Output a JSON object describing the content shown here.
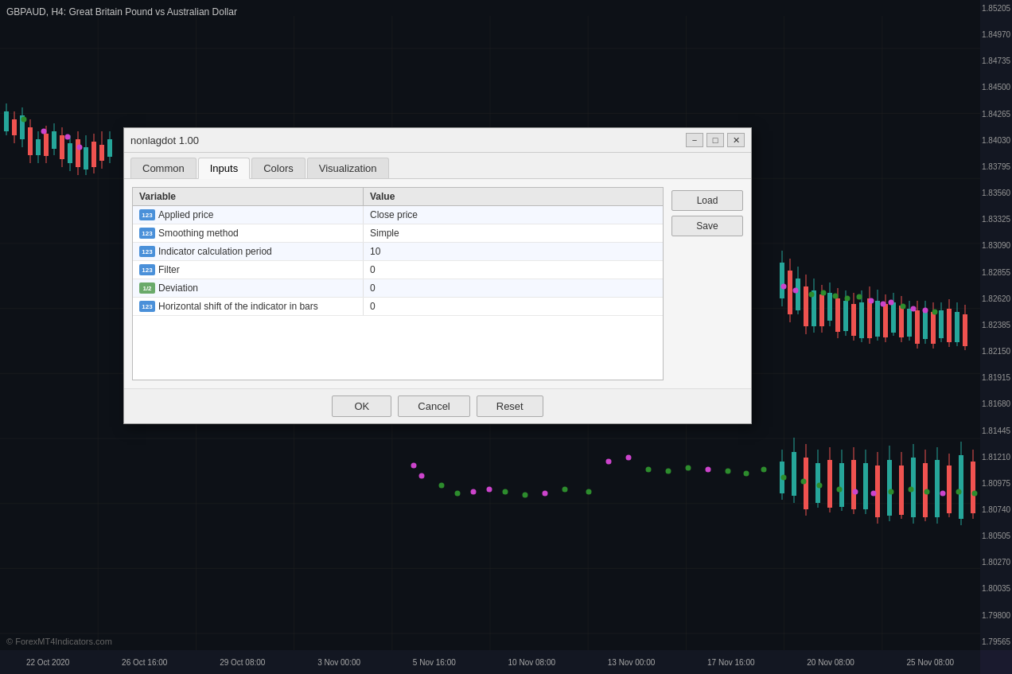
{
  "chart": {
    "title": "GBPAUD, H4:  Great Britain Pound vs Australian Dollar",
    "watermark": "© ForexMT4Indicators.com",
    "price_labels": [
      "1.85205",
      "1.84970",
      "1.84735",
      "1.84500",
      "1.84265",
      "1.84030",
      "1.83795",
      "1.83560",
      "1.83325",
      "1.83090",
      "1.82855",
      "1.82620",
      "1.82385",
      "1.82150",
      "1.81915",
      "1.81680",
      "1.81445",
      "1.81210",
      "1.80975",
      "1.80740",
      "1.80505",
      "1.80270",
      "1.80035",
      "1.79800",
      "1.79565"
    ],
    "time_labels": [
      "22 Oct 2020",
      "26 Oct 16:00",
      "29 Oct 08:00",
      "3 Nov 00:00",
      "5 Nov 16:00",
      "10 Nov 08:00",
      "13 Nov 00:00",
      "17 Nov 16:00",
      "20 Nov 08:00",
      "25 Nov 08:00"
    ]
  },
  "dialog": {
    "title": "nonlagdot 1.00",
    "tabs": [
      {
        "id": "common",
        "label": "Common",
        "active": false
      },
      {
        "id": "inputs",
        "label": "Inputs",
        "active": true
      },
      {
        "id": "colors",
        "label": "Colors",
        "active": false
      },
      {
        "id": "visualization",
        "label": "Visualization",
        "active": false
      }
    ],
    "minimize_label": "−",
    "maximize_label": "□",
    "close_label": "✕",
    "table": {
      "col_variable": "Variable",
      "col_value": "Value",
      "rows": [
        {
          "type": "123",
          "type_class": "normal",
          "variable": "Applied price",
          "value": "Close price"
        },
        {
          "type": "123",
          "type_class": "normal",
          "variable": "Smoothing method",
          "value": "Simple"
        },
        {
          "type": "123",
          "type_class": "normal",
          "variable": "Indicator calculation period",
          "value": "10"
        },
        {
          "type": "123",
          "type_class": "normal",
          "variable": "Filter",
          "value": "0"
        },
        {
          "type": "1/2",
          "type_class": "half",
          "variable": "Deviation",
          "value": "0"
        },
        {
          "type": "123",
          "type_class": "normal",
          "variable": "Horizontal shift of the indicator in bars",
          "value": "0"
        }
      ]
    },
    "buttons": {
      "load": "Load",
      "save": "Save"
    },
    "footer_buttons": {
      "ok": "OK",
      "cancel": "Cancel",
      "reset": "Reset"
    }
  }
}
